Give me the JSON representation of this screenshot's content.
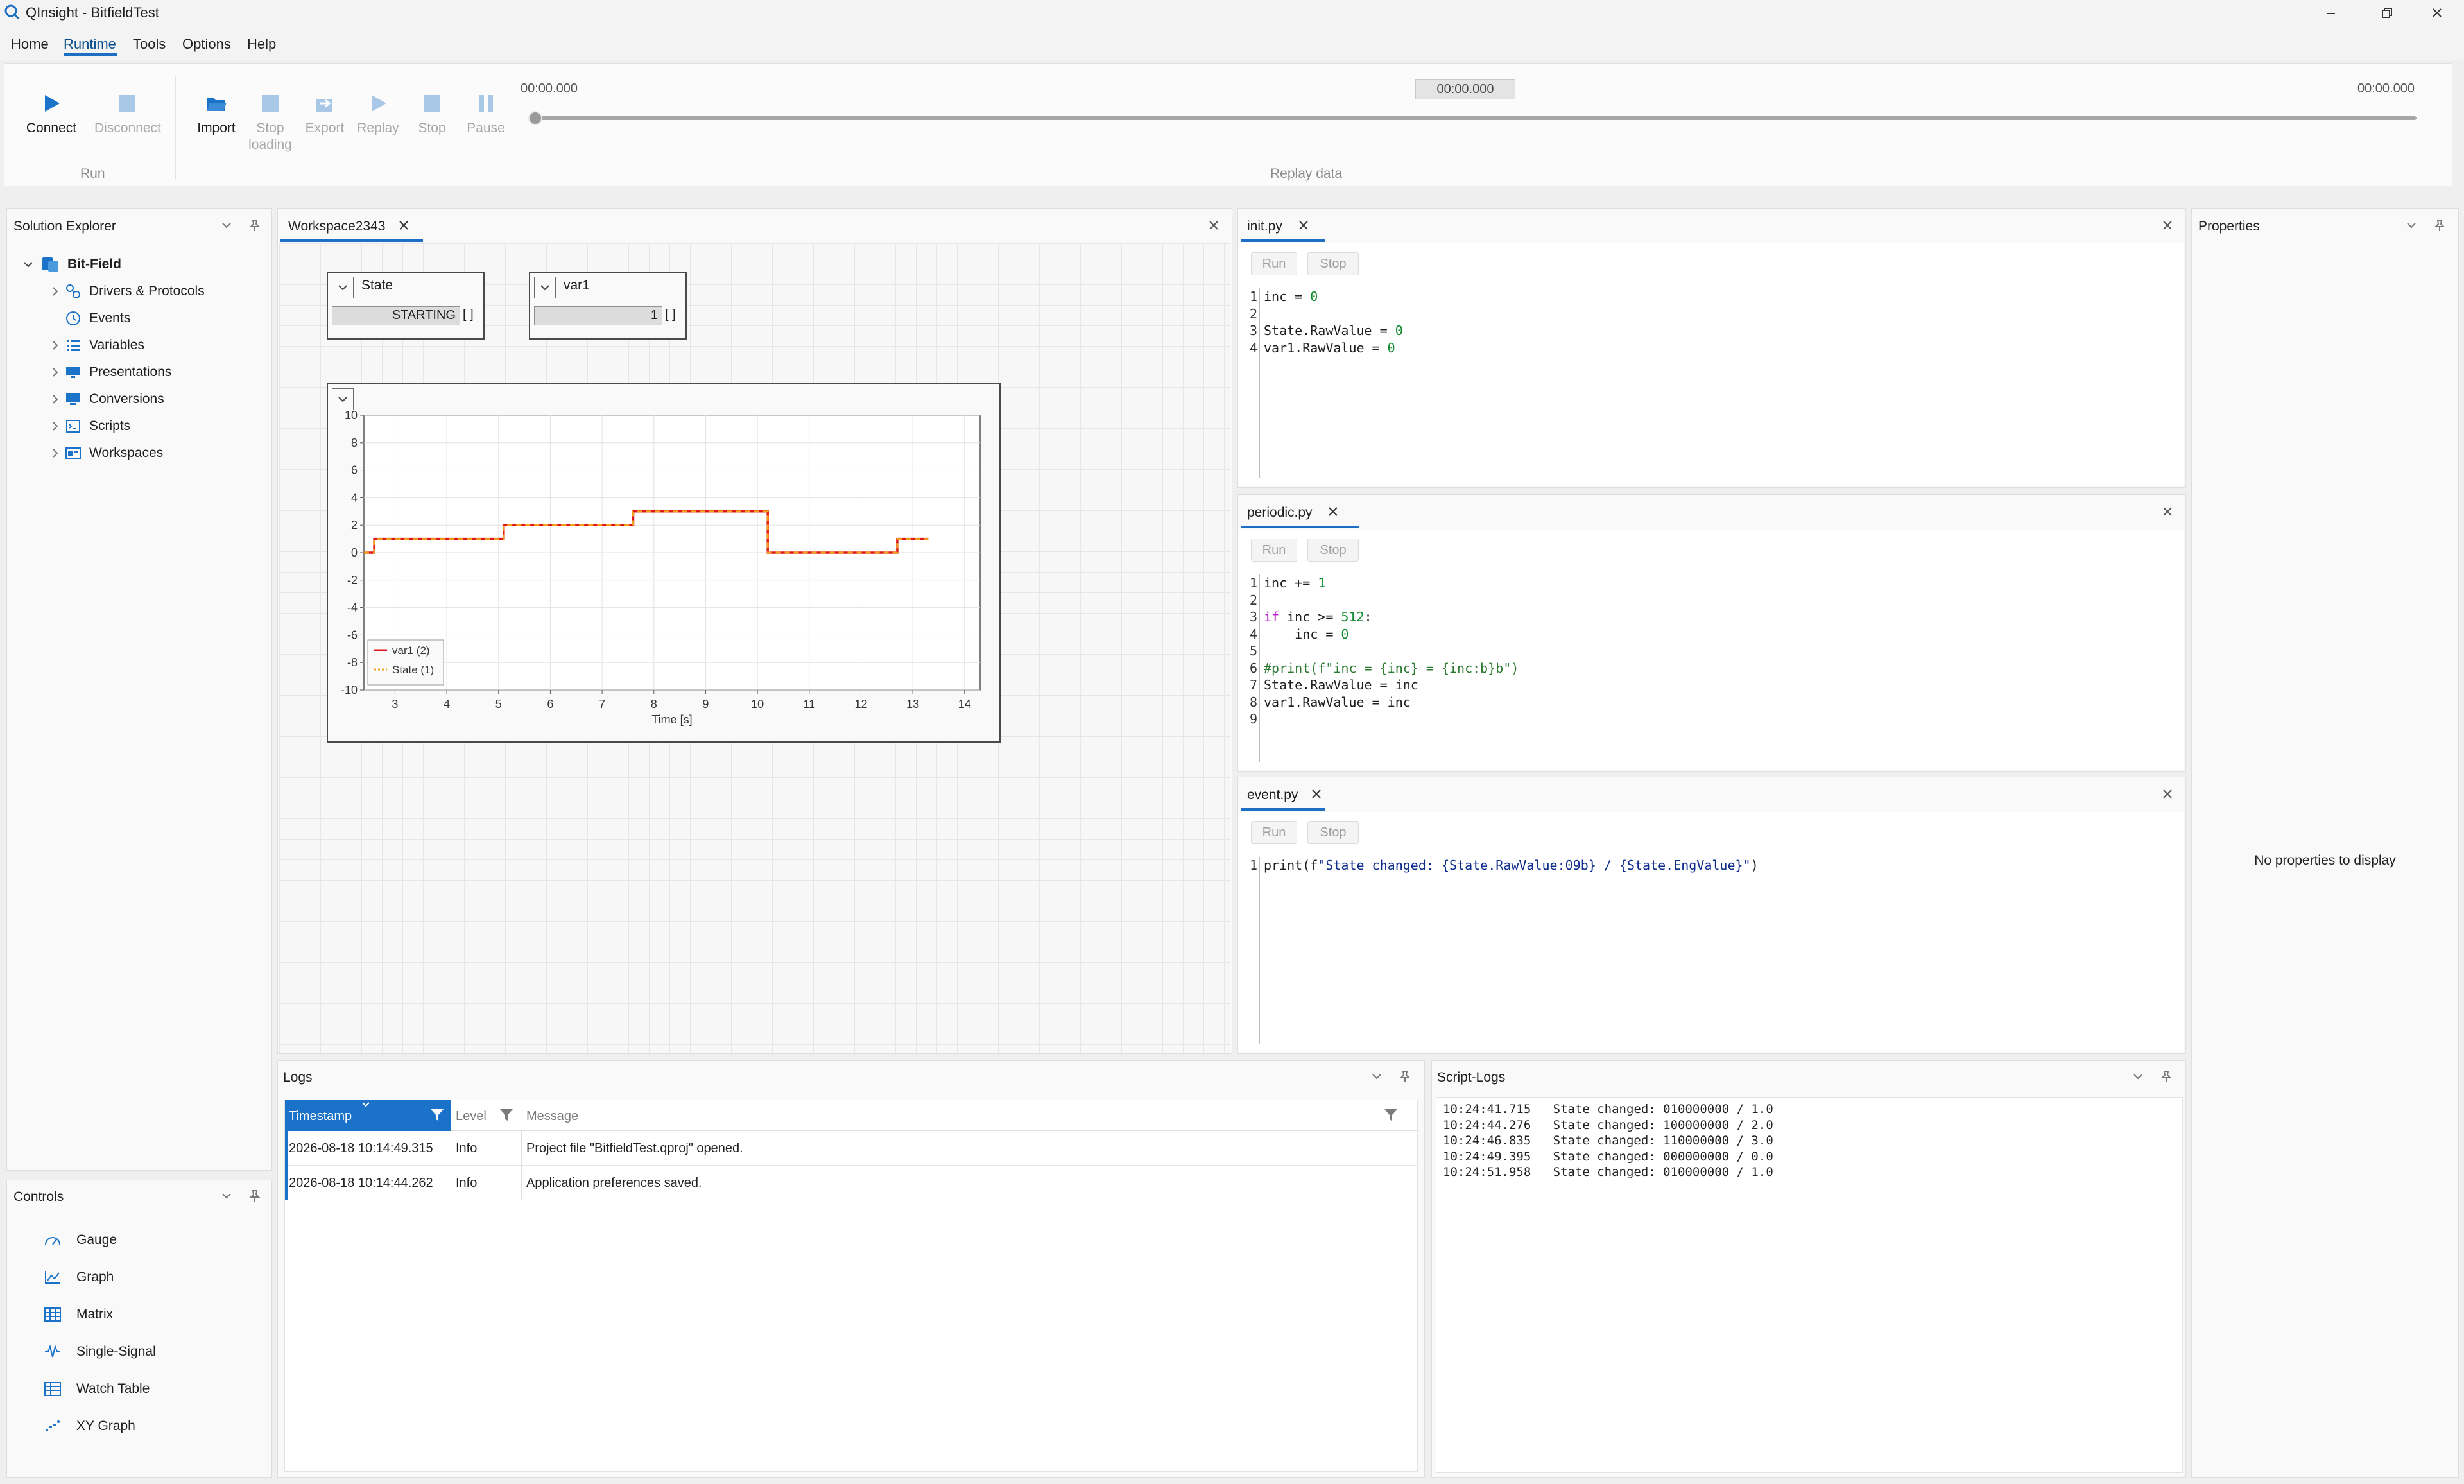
{
  "window": {
    "title": "QInsight - BitfieldTest"
  },
  "menu": {
    "items": [
      "Home",
      "Runtime",
      "Tools",
      "Options",
      "Help"
    ],
    "active": "Runtime"
  },
  "ribbon": {
    "run_group": {
      "label": "Run",
      "connect": "Connect",
      "disconnect": "Disconnect"
    },
    "replay_group": {
      "label": "Replay data",
      "import": "Import",
      "stop_loading_1": "Stop",
      "stop_loading_2": "loading",
      "export": "Export",
      "replay": "Replay",
      "stop": "Stop",
      "pause": "Pause",
      "time_start": "00:00.000",
      "time_current": "00:00.000",
      "time_end": "00:00.000",
      "progress": 0
    }
  },
  "solution_explorer": {
    "title": "Solution Explorer",
    "root": "Bit-Field",
    "items": [
      "Drivers & Protocols",
      "Events",
      "Variables",
      "Presentations",
      "Conversions",
      "Scripts",
      "Workspaces"
    ]
  },
  "controls": {
    "title": "Controls",
    "items": [
      "Gauge",
      "Graph",
      "Matrix",
      "Single-Signal",
      "Watch Table",
      "XY Graph"
    ]
  },
  "workspace": {
    "tab": "Workspace2343",
    "state_widget": {
      "title": "State",
      "value": "STARTING",
      "unit": "[ ]"
    },
    "var1_widget": {
      "title": "var1",
      "value": "1",
      "unit": "[ ]"
    }
  },
  "chart_data": {
    "type": "line",
    "xlabel": "Time [s]",
    "ylabel": "",
    "xlim": [
      2.4,
      14.3
    ],
    "ylim": [
      -10,
      10
    ],
    "xticks": [
      3,
      4,
      5,
      6,
      7,
      8,
      9,
      10,
      11,
      12,
      13,
      14
    ],
    "yticks": [
      10,
      8,
      6,
      4,
      2,
      0,
      -2,
      -4,
      -6,
      -8,
      -10
    ],
    "grid": true,
    "legend_position": "bottom-left",
    "series": [
      {
        "name": "var1 (2)",
        "color": "#e0151b",
        "step": true,
        "x": [
          2.4,
          2.6,
          2.6,
          5.1,
          5.1,
          7.6,
          7.6,
          10.2,
          10.2,
          12.7,
          12.7,
          13.3
        ],
        "y": [
          0,
          0,
          1,
          1,
          2,
          2,
          3,
          3,
          0,
          0,
          1,
          1
        ]
      },
      {
        "name": "State (1)",
        "color": "#f0a21c",
        "step": true,
        "dashed": true,
        "x": [
          2.4,
          2.6,
          2.6,
          5.1,
          5.1,
          7.6,
          7.6,
          10.2,
          10.2,
          12.7,
          12.7,
          13.3
        ],
        "y": [
          0,
          0,
          1,
          1,
          2,
          2,
          3,
          3,
          0,
          0,
          1,
          1
        ]
      }
    ]
  },
  "scripts": {
    "init": {
      "tab": "init.py",
      "run": "Run",
      "stop": "Stop",
      "lines": [
        [
          [
            "inc = ",
            "t"
          ],
          [
            "0",
            "num"
          ]
        ],
        [],
        [
          [
            "State.RawValue = ",
            "t"
          ],
          [
            "0",
            "num"
          ]
        ],
        [
          [
            "var1.RawValue = ",
            "t"
          ],
          [
            "0",
            "num"
          ]
        ]
      ]
    },
    "periodic": {
      "tab": "periodic.py",
      "run": "Run",
      "stop": "Stop",
      "lines": [
        [
          [
            "inc += ",
            "t"
          ],
          [
            "1",
            "num"
          ]
        ],
        [],
        [
          [
            "if",
            "kw"
          ],
          [
            " inc >= ",
            "t"
          ],
          [
            "512",
            "num"
          ],
          [
            ":",
            "t"
          ]
        ],
        [
          [
            "    inc = ",
            "t"
          ],
          [
            "0",
            "num"
          ]
        ],
        [],
        [
          [
            "#print(f\"inc = {inc} = {inc:b}b\")",
            "cmt"
          ]
        ],
        [
          [
            "State.RawValue = inc",
            "t"
          ]
        ],
        [
          [
            "var1.RawValue = inc",
            "t"
          ]
        ],
        []
      ]
    },
    "event": {
      "tab": "event.py",
      "run": "Run",
      "stop": "Stop",
      "lines": [
        [
          [
            "print(f",
            "t"
          ],
          [
            "\"State changed: {State.RawValue:09b} / {State.EngValue}\"",
            "str"
          ],
          [
            ")",
            "t"
          ]
        ]
      ]
    }
  },
  "properties": {
    "title": "Properties",
    "empty": "No properties to display"
  },
  "logs": {
    "title": "Logs",
    "columns": [
      "Timestamp",
      "Level",
      "Message"
    ],
    "rows": [
      [
        "2026-08-18 10:14:49.315",
        "Info",
        "Project file \"BitfieldTest.qproj\" opened."
      ],
      [
        "2026-08-18 10:14:44.262",
        "Info",
        "Application preferences saved."
      ]
    ]
  },
  "script_logs": {
    "title": "Script-Logs",
    "lines": [
      "10:24:41.715   State changed: 010000000 / 1.0",
      "10:24:44.276   State changed: 100000000 / 2.0",
      "10:24:46.835   State changed: 110000000 / 3.0",
      "10:24:49.395   State changed: 000000000 / 0.0",
      "10:24:51.958   State changed: 010000000 / 1.0"
    ]
  },
  "colors": {
    "accent": "#1c6fc2",
    "header_selected": "#1a73c8",
    "var1": "#e0151b",
    "state": "#f0a21c"
  }
}
